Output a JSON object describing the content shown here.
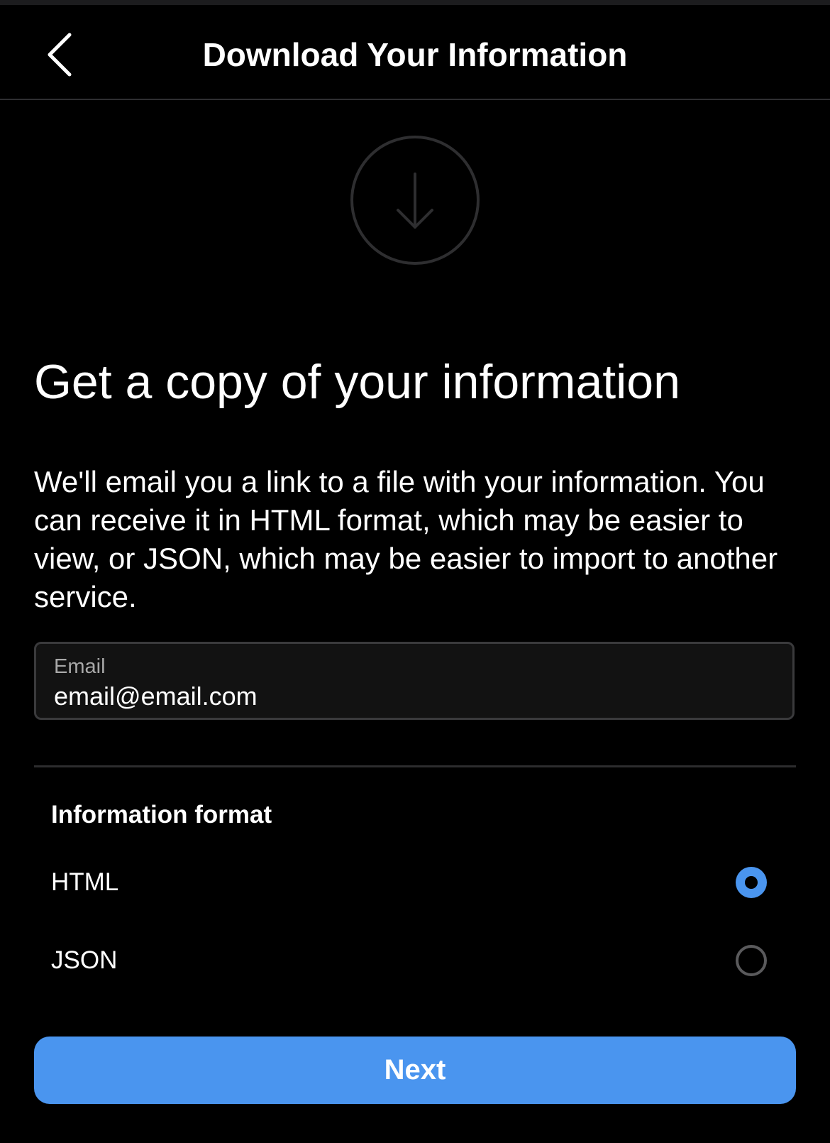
{
  "header": {
    "title": "Download Your Information",
    "back_icon": "chevron-left-icon"
  },
  "hero": {
    "icon": "download-arrow-icon"
  },
  "main": {
    "heading": "Get a copy of your information",
    "description": "We'll email you a link to a file with your information. You can receive it in HTML format, which may be easier to view, or JSON, which may be easier to import to another service."
  },
  "email_field": {
    "label": "Email",
    "value": "email@email.com"
  },
  "format_section": {
    "title": "Information format",
    "options": [
      {
        "label": "HTML",
        "selected": true
      },
      {
        "label": "JSON",
        "selected": false
      }
    ]
  },
  "next_button": {
    "label": "Next"
  },
  "colors": {
    "background": "#000000",
    "accent": "#4a95ef",
    "divider": "#2c2c2e",
    "field_border": "#3a3a3c",
    "muted_text": "#a8a8a8"
  }
}
